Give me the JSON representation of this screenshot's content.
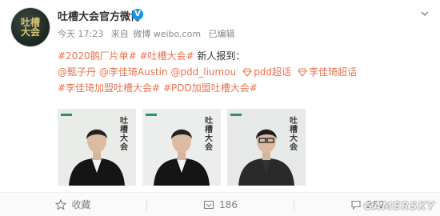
{
  "account": {
    "name": "吐槽大会官方微博",
    "avatar_text": "吐槽大会"
  },
  "post": {
    "time": "今天 17:23",
    "source_prefix": "来自",
    "source": "微博 weibo.com",
    "edited": "已编辑",
    "lines": [
      [
        {
          "text": "#2020鹅厂片单#",
          "type": "link"
        },
        {
          "text": " ",
          "type": "plain"
        },
        {
          "text": "#吐槽大会#",
          "type": "link"
        },
        {
          "text": " 新人报到：",
          "type": "plain"
        }
      ],
      [
        {
          "text": "@甄子丹",
          "type": "link"
        },
        {
          "text": " ",
          "type": "plain"
        },
        {
          "text": "@李佳琦Austin",
          "type": "link"
        },
        {
          "text": " ",
          "type": "plain"
        },
        {
          "text": "@pdd_liumou",
          "type": "link"
        },
        {
          "text": "",
          "type": "gap"
        },
        {
          "text": "pdd超话",
          "type": "super"
        },
        {
          "text": "",
          "type": "gap"
        },
        {
          "text": "李佳琦超话",
          "type": "super"
        }
      ],
      [
        {
          "text": "#李佳琦加盟吐槽大会#",
          "type": "link"
        },
        {
          "text": " ",
          "type": "plain"
        },
        {
          "text": "#PDD加盟吐槽大会#",
          "type": "link"
        }
      ]
    ],
    "images": [
      {
        "poster_text": "吐槽大会"
      },
      {
        "poster_text": "吐槽大会"
      },
      {
        "poster_text": "吐槽大会"
      }
    ]
  },
  "footer": {
    "favorite_label": "收藏",
    "repost_count": "186",
    "comment_count": "282"
  },
  "watermark": "GAMERSKY",
  "colors": {
    "link": "#eb7350",
    "verified": "#1a94e6",
    "text": "#333333",
    "meta": "#8a8a8a"
  }
}
